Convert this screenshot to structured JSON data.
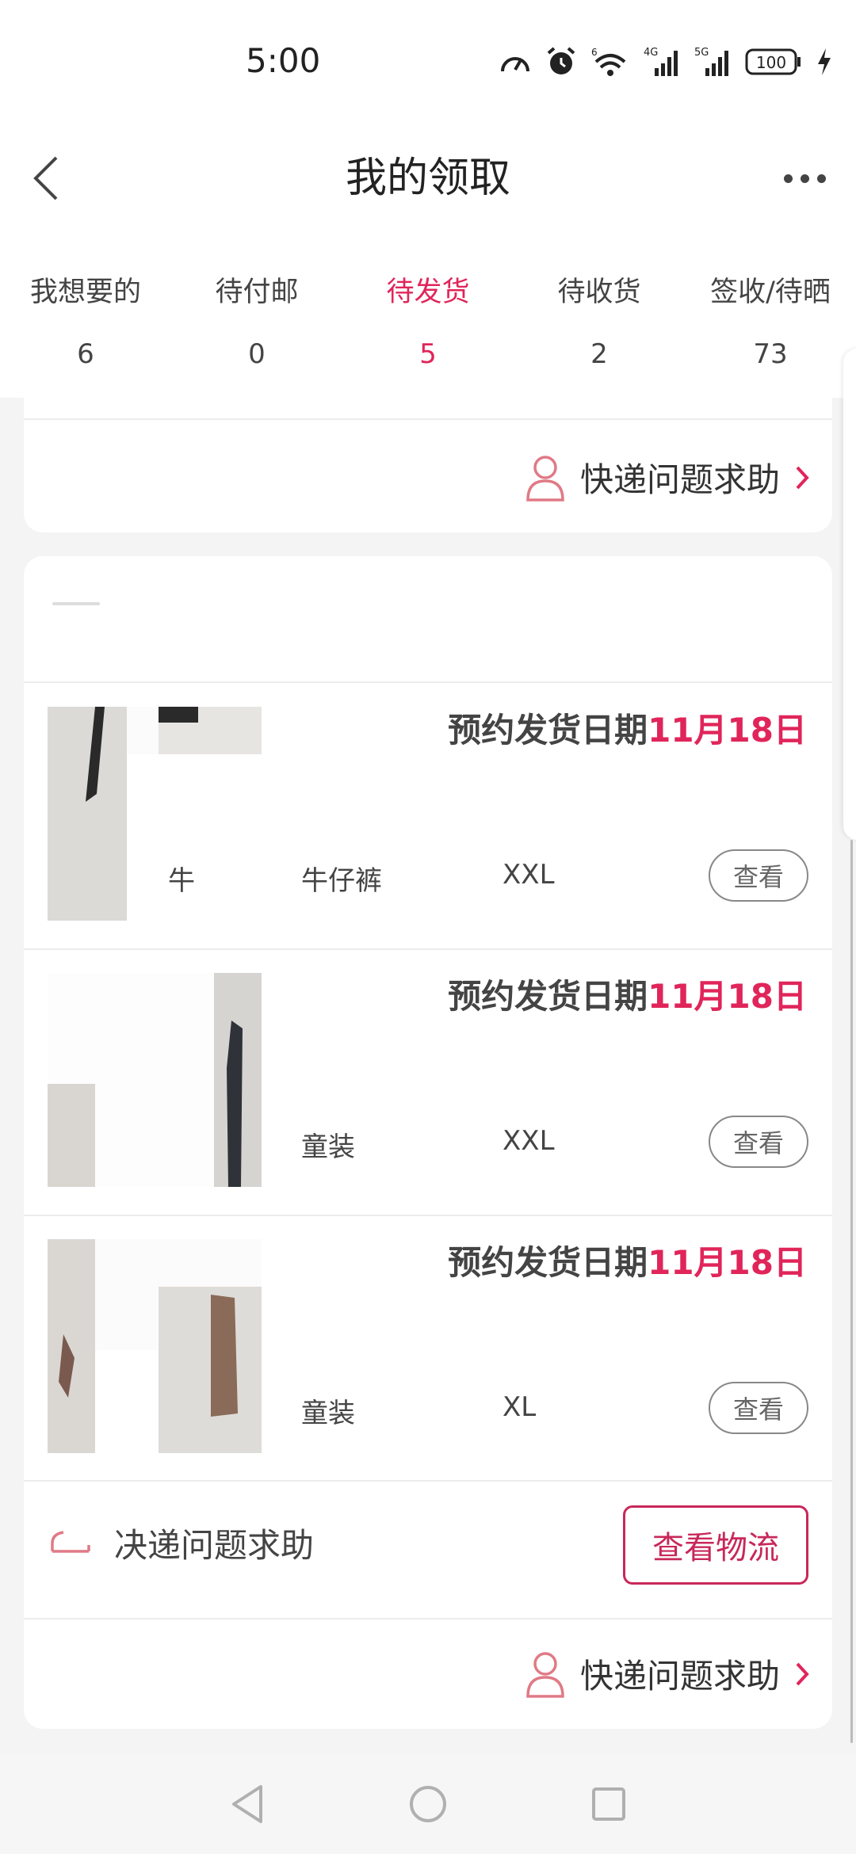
{
  "status_bar": {
    "time": "5:00",
    "battery": "100",
    "network_4g": "4G",
    "network_5g": "5G",
    "wifi_badge": "6"
  },
  "header": {
    "title": "我的领取"
  },
  "tabs": [
    {
      "label": "我想要的",
      "count": "6"
    },
    {
      "label": "待付邮",
      "count": "0"
    },
    {
      "label": "待发货",
      "count": "5",
      "active": true
    },
    {
      "label": "待收货",
      "count": "2"
    },
    {
      "label": "签收/待晒",
      "count": "73"
    }
  ],
  "card1": {
    "help_label": "快递问题求助"
  },
  "card2": {
    "items": [
      {
        "date_prefix": "预约发货日期",
        "date_value": "11月18日",
        "extra": "牛",
        "category": "牛仔裤",
        "size": "XXL",
        "view_label": "查看"
      },
      {
        "date_prefix": "预约发货日期",
        "date_value": "11月18日",
        "category": "童装",
        "size": "XXL",
        "view_label": "查看"
      },
      {
        "date_prefix": "预约发货日期",
        "date_value": "11月18日",
        "category": "童装",
        "size": "XL",
        "view_label": "查看"
      }
    ],
    "logistics_label": "决递问题求助",
    "logistics_button": "查看物流",
    "help_label": "快递问题求助"
  },
  "colors": {
    "accent": "#e0255a",
    "logistics_accent": "#c8285a"
  }
}
